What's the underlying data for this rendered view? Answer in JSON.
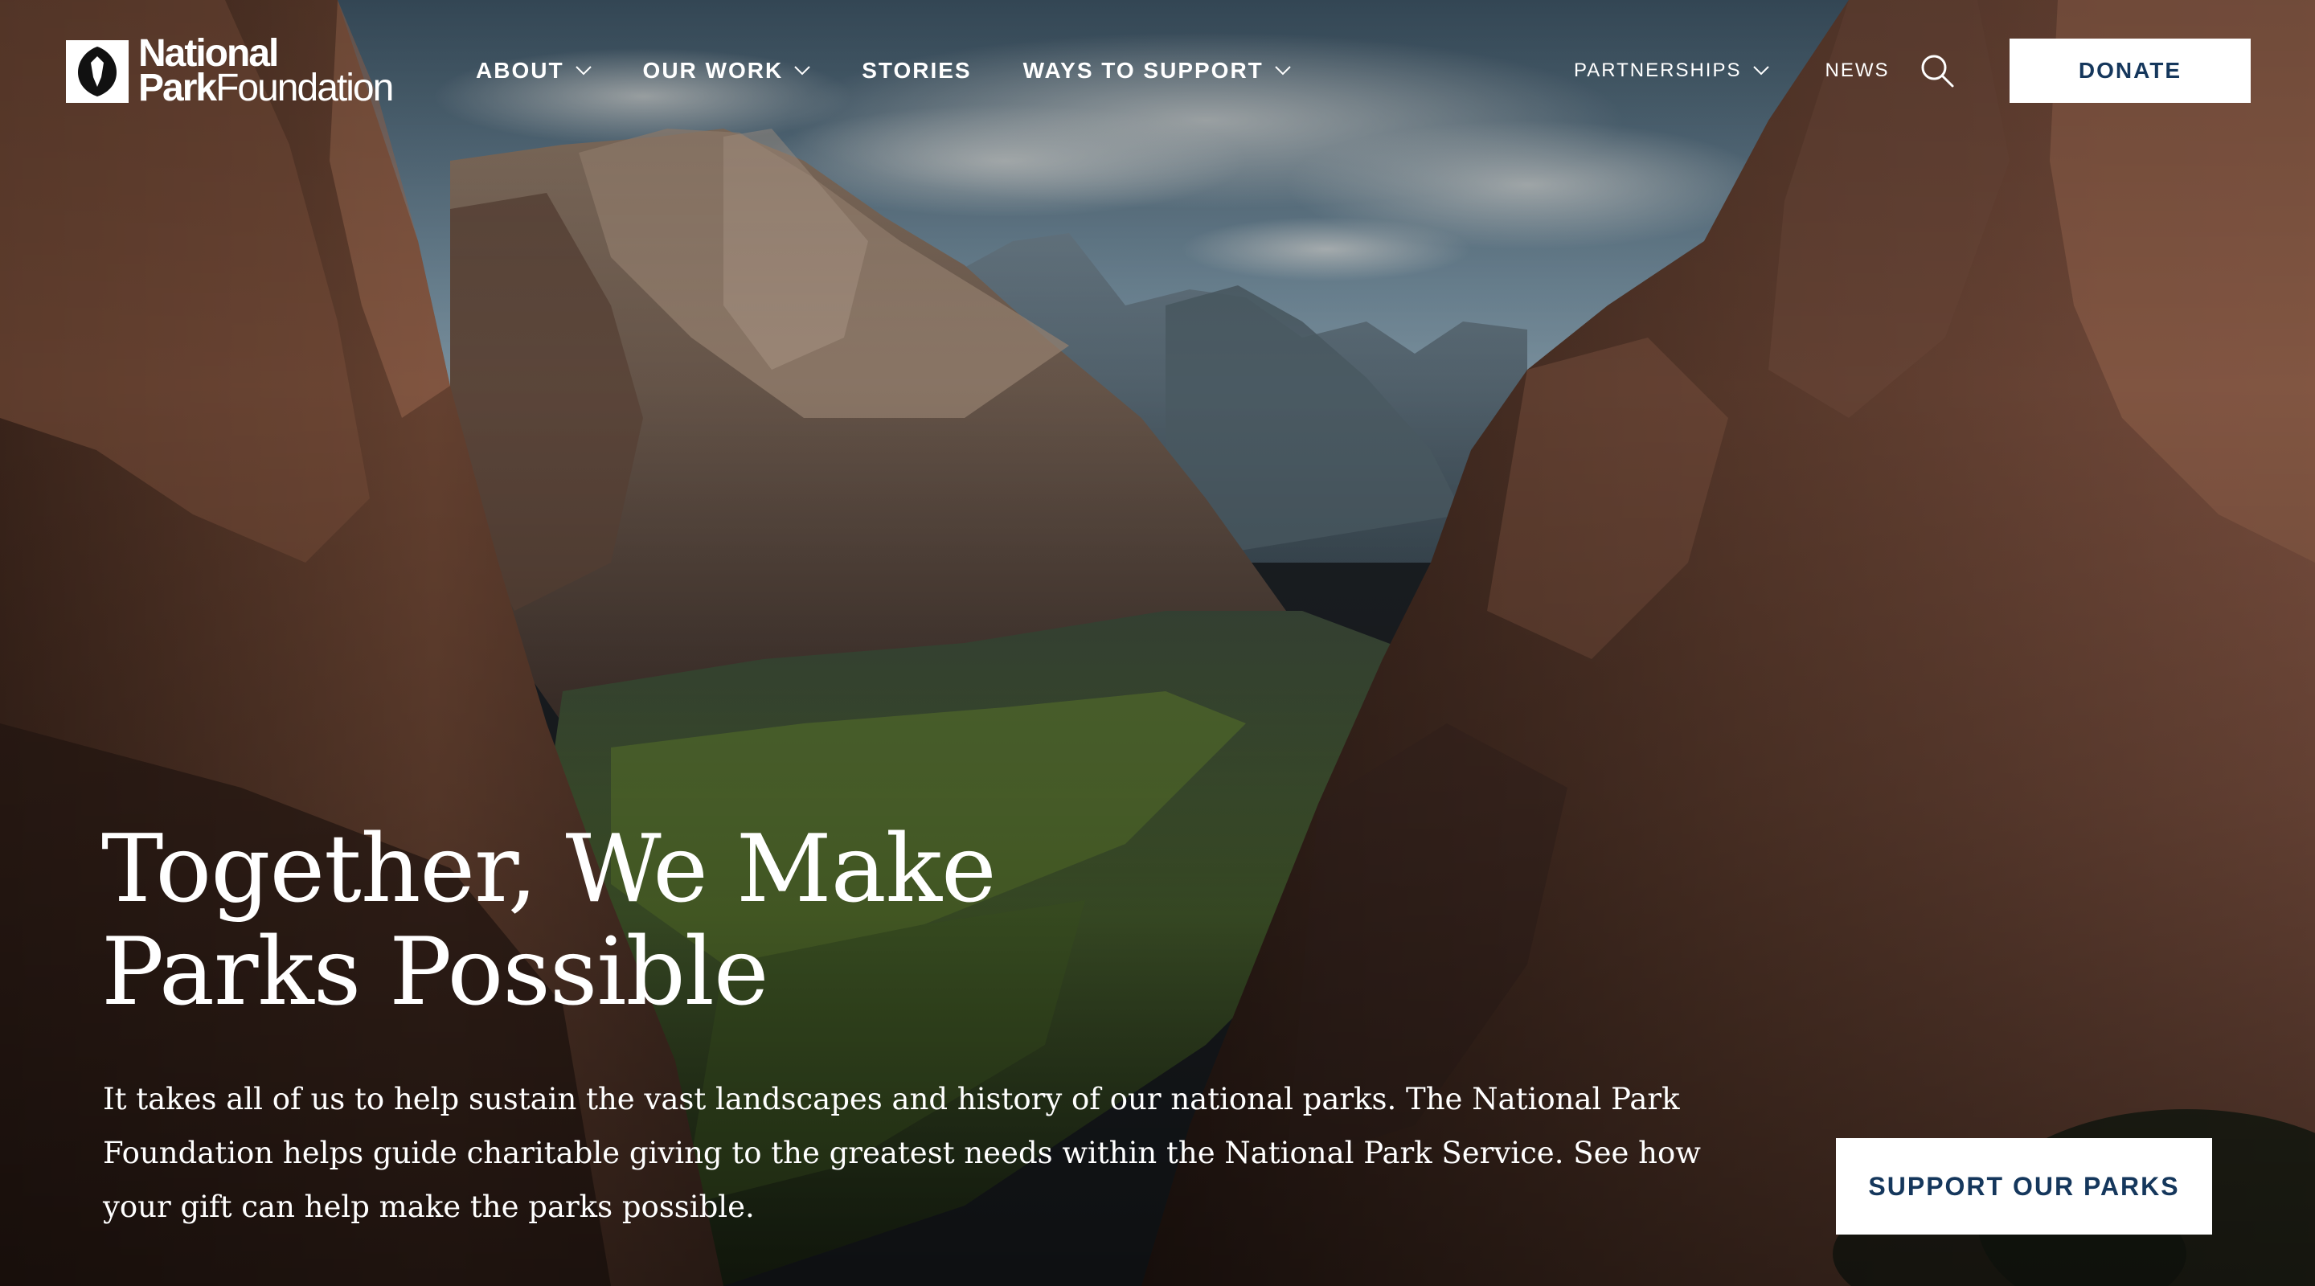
{
  "brand": {
    "name_line1": "National",
    "name_line2_bold": "Park",
    "name_line2_light": "Foundation",
    "logo_icon": "arrowhead-icon"
  },
  "nav": {
    "main": [
      {
        "label": "ABOUT",
        "has_dropdown": true
      },
      {
        "label": "OUR WORK",
        "has_dropdown": true
      },
      {
        "label": "STORIES",
        "has_dropdown": false
      },
      {
        "label": "WAYS TO SUPPORT",
        "has_dropdown": true
      }
    ],
    "utility": [
      {
        "label": "PARTNERSHIPS",
        "has_dropdown": true
      },
      {
        "label": "NEWS",
        "has_dropdown": false
      }
    ],
    "search_icon": "search-icon",
    "donate_label": "DONATE"
  },
  "hero": {
    "title_line1": "Together, We Make",
    "title_line2": "Parks Possible",
    "body": "It takes all of us to help sustain the vast landscapes and history of our national parks. The National Park Foundation helps guide charitable giving to the greatest needs within the National Park Service. See how your gift can help make the parks possible.",
    "cta_label": "SUPPORT OUR PARKS"
  },
  "colors": {
    "button_text": "#15375c",
    "button_bg": "#ffffff",
    "nav_text": "#ffffff"
  }
}
